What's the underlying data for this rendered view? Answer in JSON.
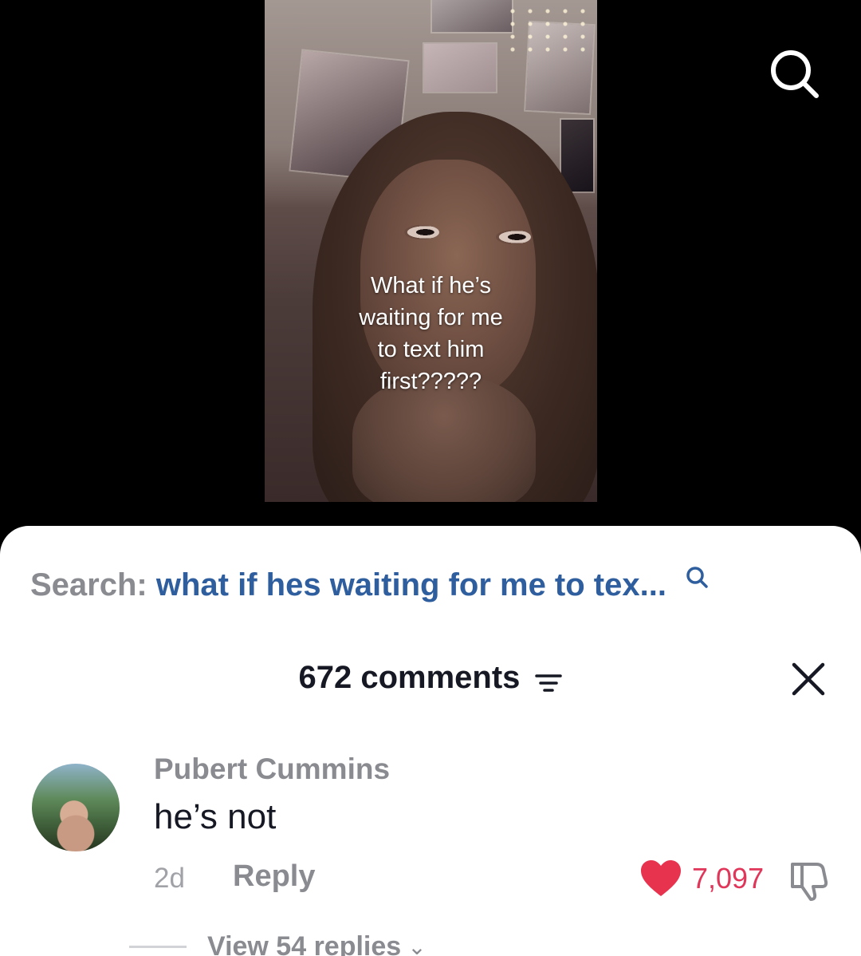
{
  "video": {
    "caption": "What if he’s\nwaiting for me\nto text him\nfirst?????"
  },
  "header": {
    "search_icon": "search-icon"
  },
  "comments_panel": {
    "search_prefix": "Search:",
    "search_query": "what if hes waiting for me to tex...",
    "comment_count_label": "672 comments",
    "sort_icon": "filter-icon",
    "close_icon": "close-icon"
  },
  "comments": [
    {
      "username": "Pubert Cummins",
      "text": "he’s not",
      "time": "2d",
      "reply_label": "Reply",
      "likes": "7,097",
      "liked": true,
      "view_replies_label": "View 54 replies"
    }
  ],
  "colors": {
    "link_blue": "#2f5e9e",
    "like_red": "#e0365a",
    "muted_gray": "#8a8b91",
    "text_dark": "#161823"
  }
}
